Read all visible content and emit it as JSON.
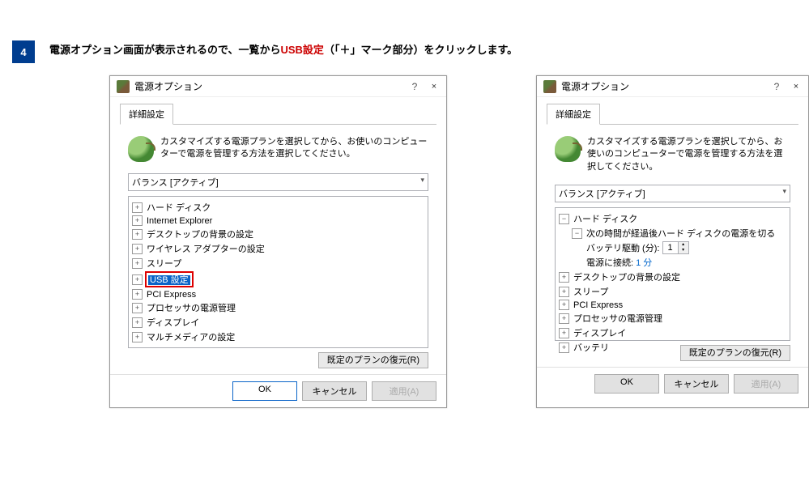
{
  "step": {
    "num": "4",
    "text_a": "電源オプション画面が表示されるので、一覧から",
    "hl": "USB設定",
    "text_b": "（「＋」マーク部分）をクリックします。"
  },
  "d": {
    "title": "電源オプション",
    "help": "?",
    "close": "×",
    "tab": "詳細設定",
    "desc": "カスタマイズする電源プランを選択してから、お使いのコンピューターで電源を管理する方法を選択してください。",
    "combo": "バランス [アクティブ]",
    "restore": "既定のプランの復元(R)",
    "ok": "OK",
    "cancel": "キャンセル",
    "apply": "適用(A)"
  },
  "left_tree": [
    "ハード ディスク",
    "Internet Explorer",
    "デスクトップの背景の設定",
    "ワイヤレス アダプターの設定",
    "スリープ",
    "USB 設定",
    "PCI Express",
    "プロセッサの電源管理",
    "ディスプレイ",
    "マルチメディアの設定"
  ],
  "right_tree": {
    "hd": "ハード ディスク",
    "hd_sub": "次の時間が経過後ハード ディスクの電源を切る",
    "bat": "バッテリ駆動 (分):",
    "bat_v": "1",
    "ac": "電源に接続:",
    "ac_v": "1 分",
    "rest": [
      "デスクトップの背景の設定",
      "スリープ",
      "PCI Express",
      "プロセッサの電源管理",
      "ディスプレイ",
      "バッテリ"
    ]
  }
}
